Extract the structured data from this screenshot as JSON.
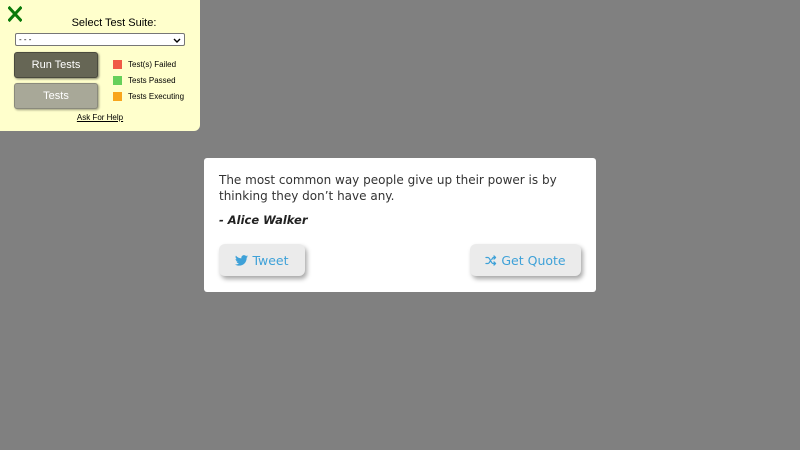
{
  "test_panel": {
    "suite_label": "Select Test Suite:",
    "suite_select_value": "- - -",
    "run_tests_label": "Run Tests",
    "tests_label": "Tests",
    "legend": [
      {
        "label": "Test(s) Failed",
        "color": "#f05a46"
      },
      {
        "label": "Tests Passed",
        "color": "#66d05a"
      },
      {
        "label": "Tests Executing",
        "color": "#f8a51c"
      }
    ],
    "help_link": "Ask For Help",
    "close_icon": "close-icon",
    "close_color": "#0a7a0a"
  },
  "quote": {
    "text": "The most common way people give up their power is by thinking they don’t have any.",
    "author": "- Alice Walker",
    "tweet_label": "Tweet",
    "tweet_icon": "twitter-icon",
    "new_quote_label": "Get Quote",
    "new_quote_icon": "shuffle-icon",
    "accent_color": "#3ea1d8"
  },
  "page": {
    "background_color": "#808080"
  }
}
